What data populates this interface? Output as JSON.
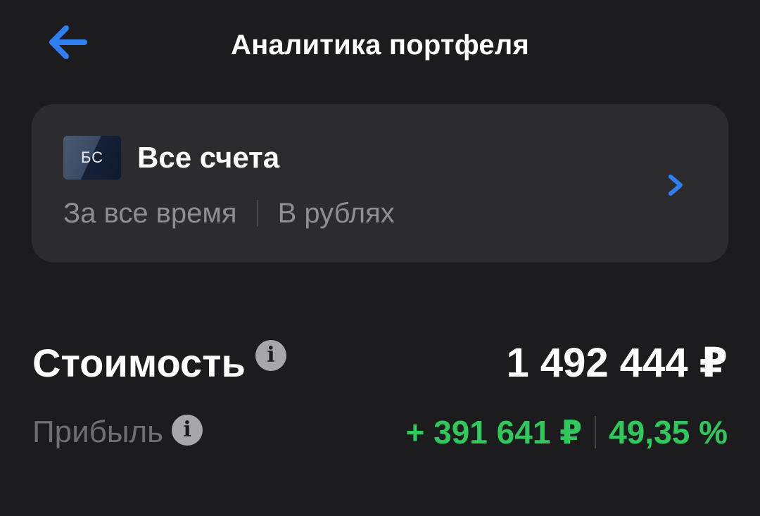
{
  "header": {
    "title": "Аналитика портфеля",
    "back_icon": "arrow-left-icon",
    "accent_color": "#2f7ff3"
  },
  "account": {
    "badge": "БС",
    "title": "Все счета",
    "period": "За все время",
    "currency": "В рублях",
    "chevron_icon": "chevron-right-icon"
  },
  "portfolio": {
    "value_label": "Стоимость",
    "value": "1 492 444 ₽",
    "profit_label": "Прибыль",
    "profit_amount": "+ 391 641 ₽",
    "profit_percent": "49,35 %",
    "profit_color": "#30c75c",
    "info_icon": "info-icon"
  }
}
